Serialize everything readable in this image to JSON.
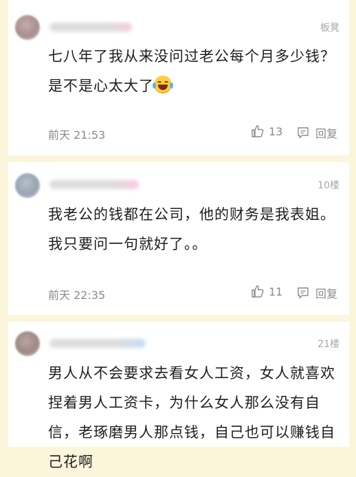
{
  "comments": [
    {
      "floor": "板凳",
      "text": "七八年了我从来没问过老公每个月多少钱？是不是心太大了",
      "emoji": "tears-of-joy-emoji",
      "time": "前天 21:53",
      "likes": "13",
      "reply_label": "回复"
    },
    {
      "floor": "10楼",
      "text": "我老公的钱都在公司，他的财务是我表姐。我只要问一句就好了。。",
      "time": "前天 22:35",
      "likes": "11",
      "reply_label": "回复"
    },
    {
      "floor": "21楼",
      "text": "男人从不会要求去看女人工资，女人就喜欢捏着男人工资卡，为什么女人那么没有自信，老琢磨男人那点钱，自己也可以赚钱自己花啊"
    }
  ],
  "colors": {
    "page_background": "#fbf5dc",
    "card_background": "#ffffff",
    "meta_text": "#8a8a8a"
  }
}
